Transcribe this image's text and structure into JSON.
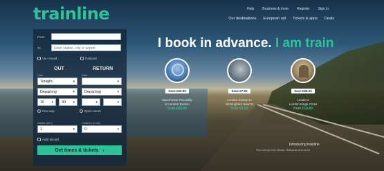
{
  "brand": {
    "logo": "trainline"
  },
  "top_nav": [
    "Help",
    "Business & more",
    "Register",
    "Sign in"
  ],
  "sub_nav": [
    "Our destinations",
    "European rail",
    "Tickets & apps",
    "Deals"
  ],
  "search": {
    "from_label": "From",
    "to_label": "To",
    "from_placeholder": "",
    "to_placeholder": "Enter station, city or airport",
    "via_label": "Via / Avoid",
    "railcard_label": "Railcard",
    "out_heading": "OUT",
    "return_heading": "RETURN",
    "out_date_label": "Date",
    "return_date_label": "Date",
    "out_time_label": "Time",
    "return_time_label": "Time",
    "out_date": "Tonight",
    "return_date": "",
    "out_mode": "Departing",
    "return_mode": "Departing",
    "out_hour": "16",
    "out_min": "30",
    "return_hour": "",
    "return_min": "",
    "single_label": "One way",
    "open_return_label": "Open return",
    "adults_label": "Adults (26+)",
    "children_label": "Children (0-15)",
    "adults_value": "1",
    "children_value": "0",
    "add_railcard_label": "Add railcard",
    "cta_label": "Get times & tickets",
    "cta_arrow": "›"
  },
  "hero": {
    "headline_main": "I book in advance.",
    "headline_accent": "I am train"
  },
  "deals": [
    {
      "save": "Save £60.00",
      "route_line1": "Manchester Piccadilly",
      "route_line2": "to London Euston",
      "price": "from £20.00"
    },
    {
      "save": "Save £7.00",
      "route_line1": "London Euston to",
      "route_line2": "Birmingham New St",
      "price": "from £5.00"
    },
    {
      "save": "Save £65.20",
      "route_line1": "Leeds to",
      "route_line2": "London Kings Cross",
      "price": "from £18.60"
    }
  ],
  "intro": {
    "title": "Introducing trainline",
    "subtitle": "Find cheap train tickets, Railcards and more"
  },
  "colors": {
    "brand": "#2fc29a",
    "panel": "#142838",
    "text_light": "#e8eef2"
  }
}
